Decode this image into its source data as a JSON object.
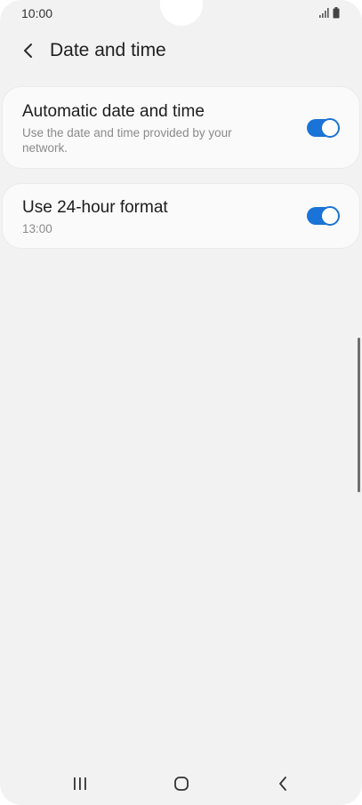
{
  "status_bar": {
    "time": "10:00",
    "icons": [
      "signal-icon",
      "battery-icon"
    ]
  },
  "header": {
    "back_icon": "chevron-left-icon",
    "title": "Date and time"
  },
  "settings": {
    "items": [
      {
        "title": "Automatic date and time",
        "subtitle": "Use the date and time provided by your network.",
        "toggle_on": true
      },
      {
        "title": "Use 24-hour format",
        "subtitle": "13:00",
        "toggle_on": true
      }
    ]
  },
  "nav_bar": {
    "icons": [
      "recents-icon",
      "home-icon",
      "back-icon"
    ]
  },
  "colors": {
    "accent": "#1a73d6",
    "background": "#f2f2f2",
    "card": "#fafafa"
  }
}
